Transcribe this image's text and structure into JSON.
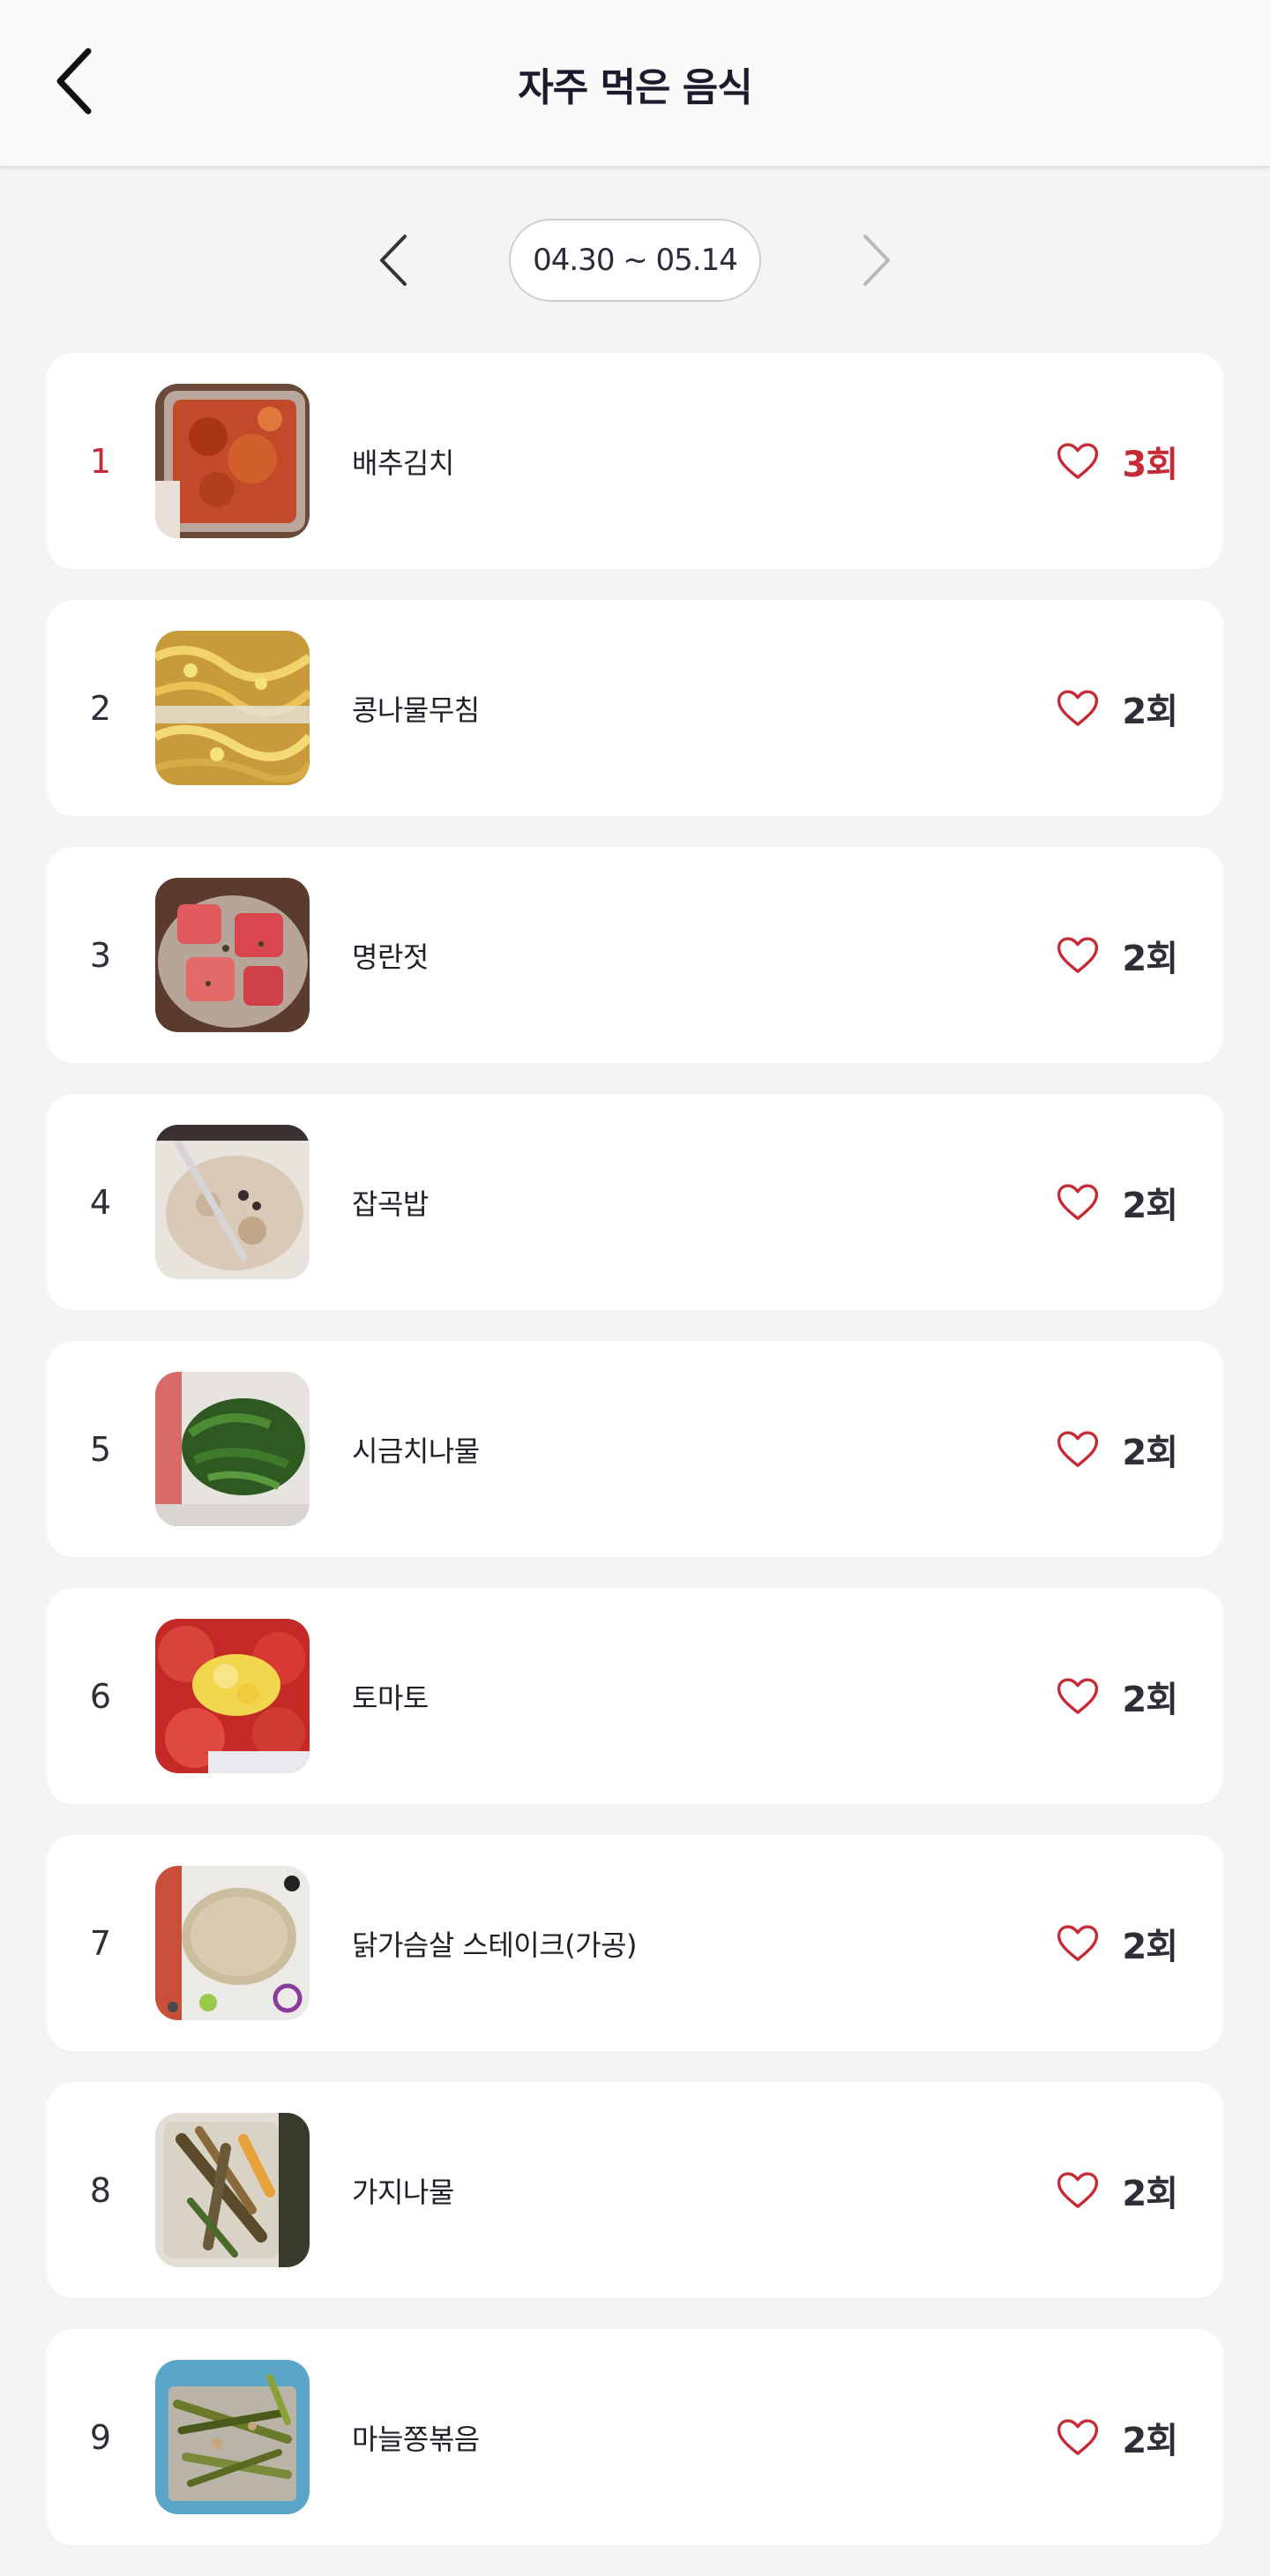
{
  "header": {
    "title": "자주 먹은 음식"
  },
  "date_range": {
    "label": "04.30 ~ 05.14"
  },
  "colors": {
    "accent": "#c72a35",
    "text": "#2f2f3a",
    "background": "#f4f4f4",
    "card": "#ffffff"
  },
  "foods": [
    {
      "rank": "1",
      "name": "배추김치",
      "count": "3회",
      "icon": "heart-outline-icon"
    },
    {
      "rank": "2",
      "name": "콩나물무침",
      "count": "2회",
      "icon": "heart-outline-icon"
    },
    {
      "rank": "3",
      "name": "명란젓",
      "count": "2회",
      "icon": "heart-outline-icon"
    },
    {
      "rank": "4",
      "name": "잡곡밥",
      "count": "2회",
      "icon": "heart-outline-icon"
    },
    {
      "rank": "5",
      "name": "시금치나물",
      "count": "2회",
      "icon": "heart-outline-icon"
    },
    {
      "rank": "6",
      "name": "토마토",
      "count": "2회",
      "icon": "heart-outline-icon"
    },
    {
      "rank": "7",
      "name": "닭가슴살 스테이크(가공)",
      "count": "2회",
      "icon": "heart-outline-icon"
    },
    {
      "rank": "8",
      "name": "가지나물",
      "count": "2회",
      "icon": "heart-outline-icon"
    },
    {
      "rank": "9",
      "name": "마늘쫑볶음",
      "count": "2회",
      "icon": "heart-outline-icon"
    }
  ]
}
